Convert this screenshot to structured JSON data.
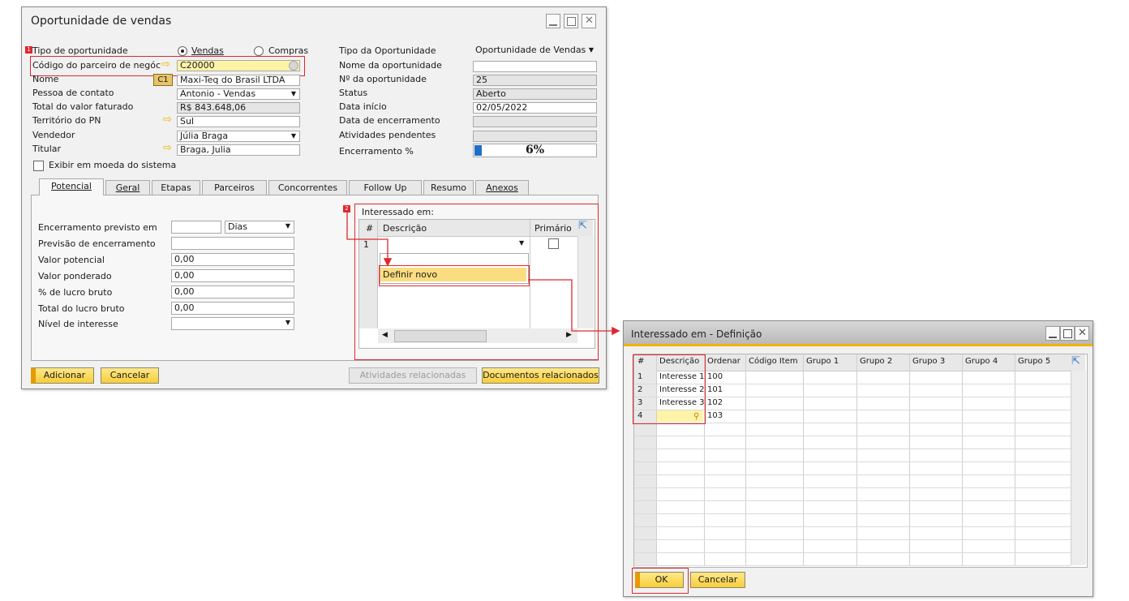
{
  "main": {
    "title": "Oportunidade de vendas",
    "left_labels": {
      "tipo": "Tipo de oportunidade",
      "codigo": "Código do parceiro de negóc",
      "nome": "Nome",
      "pessoa": "Pessoa de contato",
      "total": "Total do valor faturado",
      "territorio": "Território do PN",
      "vendedor": "Vendedor",
      "titular": "Titular"
    },
    "radio_vendas": "Vendas",
    "radio_compras": "Compras",
    "left_values": {
      "codigo": "C20000",
      "nome": "Maxi-Teq do Brasil LTDA",
      "pessoa": "Antonio - Vendas",
      "total": "R$ 843.648,06",
      "territorio": "Sul",
      "vendedor": "Júlia Braga",
      "titular": "Braga, Julia"
    },
    "currency_badge": "C1",
    "right_labels": {
      "tipo": "Tipo da Oportunidade",
      "nome": "Nome da oportunidade",
      "numero": "Nº da oportunidade",
      "status": "Status",
      "inicio": "Data início",
      "encerramento": "Data de encerramento",
      "atividades": "Atividades pendentes",
      "percent": "Encerramento %"
    },
    "right_values": {
      "tipo": "Oportunidade de Vendas",
      "nome": "",
      "numero": "25",
      "status": "Aberto",
      "inicio": "02/05/2022",
      "encerramento": "",
      "atividades": "",
      "percent": "6%"
    },
    "progress_fraction": 0.06,
    "exibir_moeda": "Exibir em moeda do sistema",
    "tabs": [
      "Potencial",
      "Geral",
      "Etapas",
      "Parceiros",
      "Concorrentes",
      "Follow Up",
      "Resumo",
      "Anexos"
    ],
    "potencial": {
      "encerramento_previsto": "Encerramento previsto em",
      "unidade": "Dias",
      "previsao": "Previsão de encerramento",
      "valor_potencial": "Valor potencial",
      "valor_ponderado": "Valor ponderado",
      "lucro_pct": "% de lucro bruto",
      "total_lucro": "Total do lucro bruto",
      "nivel": "Nível de interesse",
      "valor_potencial_val": "0,00",
      "valor_ponderado_val": "0,00",
      "lucro_pct_val": "0,00",
      "total_lucro_val": "0,00"
    },
    "interessado": {
      "title": "Interessado em:",
      "col_hash": "#",
      "col_desc": "Descrição",
      "col_prim": "Primário",
      "row1": "1",
      "definir_novo": "Definir novo"
    },
    "buttons": {
      "adicionar": "Adicionar",
      "cancelar": "Cancelar",
      "atividades": "Atividades relacionadas",
      "documentos": "Documentos relacionados"
    },
    "badge1": "1",
    "badge2": "2"
  },
  "popup": {
    "title": "Interessado em - Definição",
    "columns": [
      "#",
      "Descrição",
      "Ordenar",
      "Código Item",
      "Grupo 1",
      "Grupo 2",
      "Grupo 3",
      "Grupo 4",
      "Grupo 5"
    ],
    "rows": [
      [
        "1",
        "Interesse 1",
        "100"
      ],
      [
        "2",
        "Interesse 2",
        "101"
      ],
      [
        "3",
        "Interesse 3",
        "102"
      ],
      [
        "4",
        "",
        "103"
      ]
    ],
    "ok": "OK",
    "cancelar": "Cancelar"
  }
}
